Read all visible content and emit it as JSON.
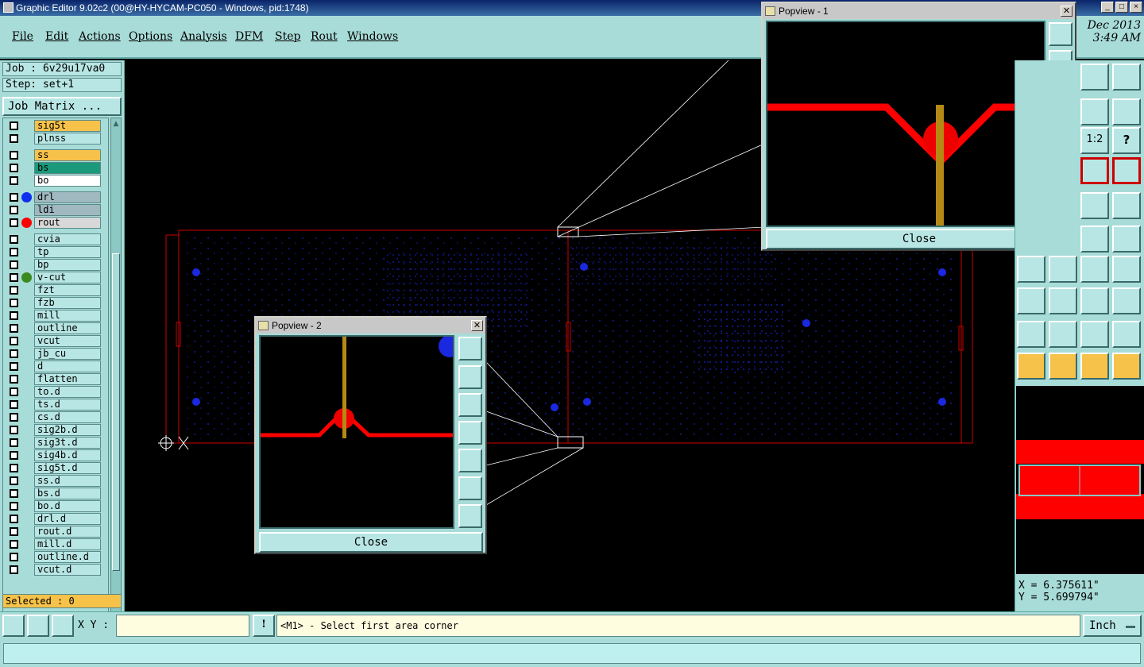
{
  "window": {
    "title": "Graphic Editor 9.02c2 (00@HY-HYCAM-PC050 - Windows, pid:1748)",
    "controls": [
      "_",
      "□",
      "×"
    ]
  },
  "menu": [
    "File",
    "Edit",
    "Actions",
    "Options",
    "Analysis",
    "DFM",
    "Step",
    "Rout",
    "Windows"
  ],
  "datetime": {
    "date": "Dec 2013",
    "time": "3:49 AM"
  },
  "job": {
    "job_line": "Job : 6v29u17va0",
    "step_line": "Step: set+1",
    "matrix_button": "Job Matrix ..."
  },
  "layers": [
    {
      "name": "sig5t",
      "color": "#f6c24a"
    },
    {
      "name": "plnss",
      "color": "#b8e6e4"
    },
    {
      "name": "ss",
      "color": "#f6c24a"
    },
    {
      "name": "bs",
      "color": "#1a9a7a"
    },
    {
      "name": "bo",
      "color": "#ffffff"
    },
    {
      "name": "drl",
      "color": "#a0b8c0",
      "dot": "#1030f0"
    },
    {
      "name": "ldi",
      "color": "#a0b8c0"
    },
    {
      "name": "rout",
      "color": "#d8d8d8",
      "dot": "#ff0000"
    },
    {
      "name": "cvia",
      "color": "#b8e6e4"
    },
    {
      "name": "tp",
      "color": "#b8e6e4"
    },
    {
      "name": "bp",
      "color": "#b8e6e4"
    },
    {
      "name": "v-cut",
      "color": "#b8e6e4",
      "dot": "#3a8a20"
    },
    {
      "name": "fzt",
      "color": "#b8e6e4"
    },
    {
      "name": "fzb",
      "color": "#b8e6e4"
    },
    {
      "name": "mill",
      "color": "#b8e6e4"
    },
    {
      "name": "outline",
      "color": "#b8e6e4"
    },
    {
      "name": "vcut",
      "color": "#b8e6e4"
    },
    {
      "name": "jb_cu",
      "color": "#b8e6e4"
    },
    {
      "name": "d",
      "color": "#b8e6e4"
    },
    {
      "name": "flatten",
      "color": "#b8e6e4"
    },
    {
      "name": "to.d",
      "color": "#b8e6e4"
    },
    {
      "name": "ts.d",
      "color": "#b8e6e4"
    },
    {
      "name": "cs.d",
      "color": "#b8e6e4"
    },
    {
      "name": "sig2b.d",
      "color": "#b8e6e4"
    },
    {
      "name": "sig3t.d",
      "color": "#b8e6e4"
    },
    {
      "name": "sig4b.d",
      "color": "#b8e6e4"
    },
    {
      "name": "sig5t.d",
      "color": "#b8e6e4"
    },
    {
      "name": "ss.d",
      "color": "#b8e6e4"
    },
    {
      "name": "bs.d",
      "color": "#b8e6e4"
    },
    {
      "name": "bo.d",
      "color": "#b8e6e4"
    },
    {
      "name": "drl.d",
      "color": "#b8e6e4"
    },
    {
      "name": "rout.d",
      "color": "#b8e6e4"
    },
    {
      "name": "mill.d",
      "color": "#b8e6e4"
    },
    {
      "name": "outline.d",
      "color": "#b8e6e4"
    },
    {
      "name": "vcut.d",
      "color": "#b8e6e4"
    }
  ],
  "selected": "Selected : 0",
  "popview1": {
    "title": "Popview - 1",
    "close_label": "Close"
  },
  "popview2": {
    "title": "Popview - 2",
    "close_label": "Close"
  },
  "tools": {
    "scale_label": "1:2",
    "help_label": "?"
  },
  "coords": {
    "x": "X = 6.375611\"",
    "y": "Y = 5.699794\""
  },
  "bottom": {
    "xy_label": "X Y :",
    "xy_value": "",
    "prompt": "<M1> - Select first area corner",
    "units": "Inch",
    "warn": "!"
  }
}
